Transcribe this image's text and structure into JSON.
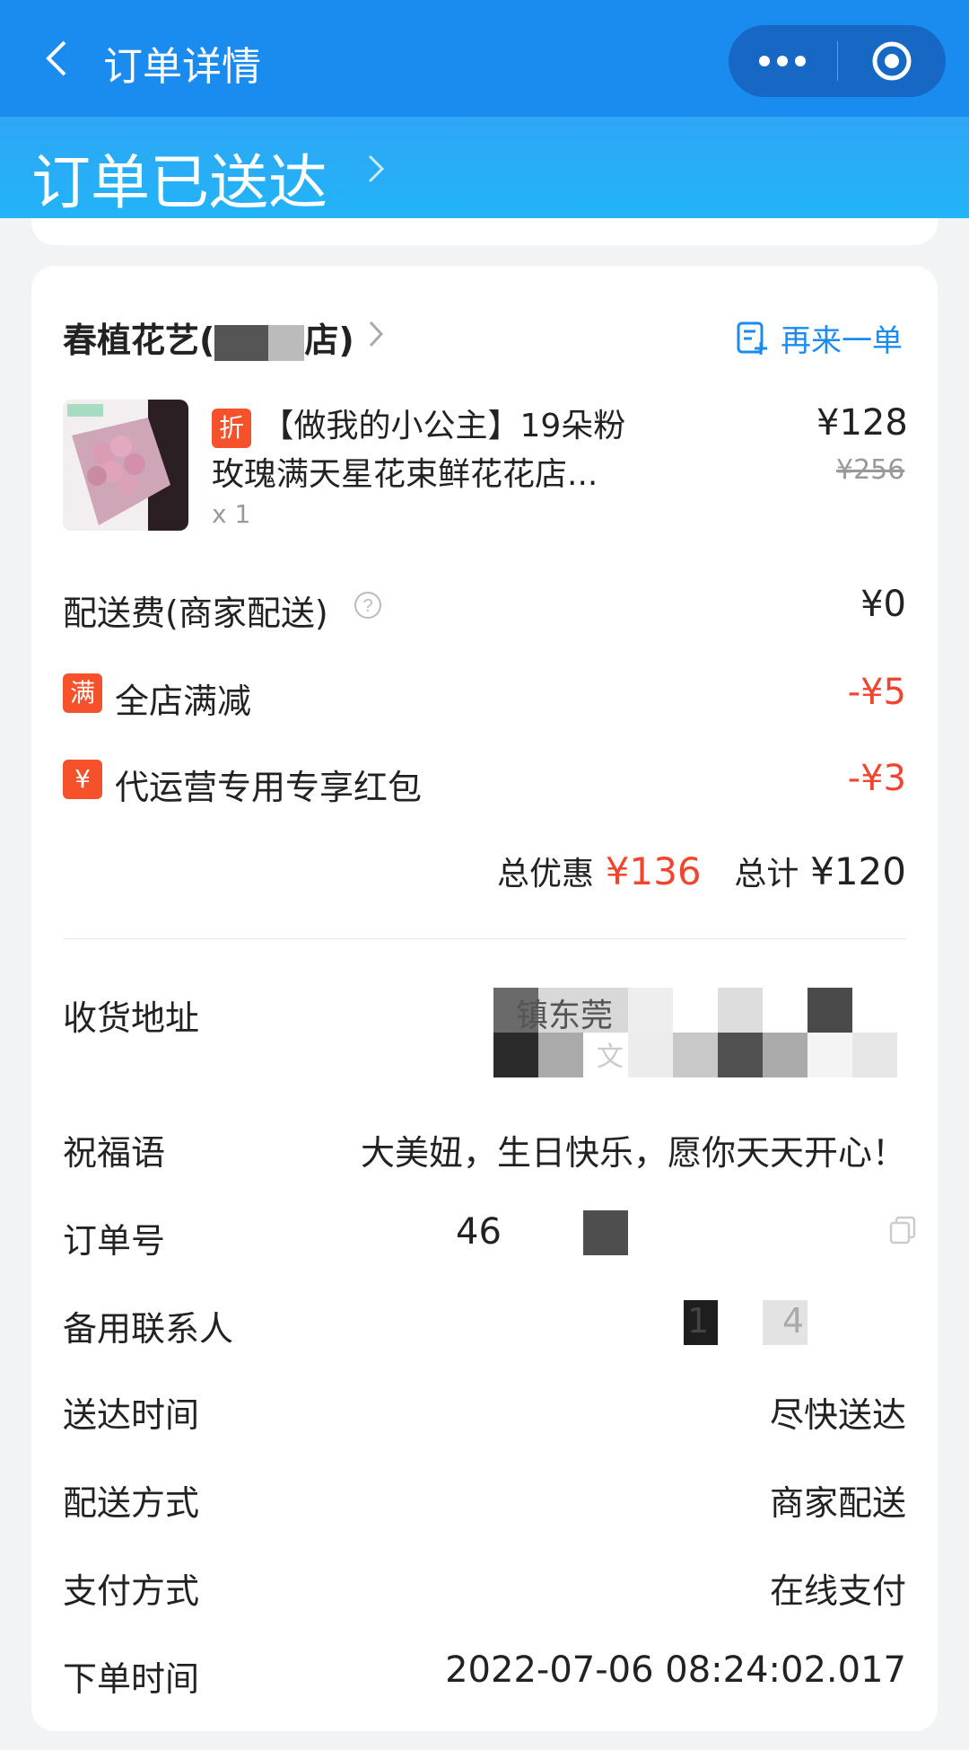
{
  "nav": {
    "title": "订单详情"
  },
  "status": {
    "text": "订单已送达"
  },
  "shop": {
    "name_prefix": "春植花艺(",
    "name_suffix": "店)",
    "reorder_label": "再来一单"
  },
  "product": {
    "tag": "折",
    "title_line1": "【做我的小公主】19朵粉",
    "title_line2": "玫瑰满天星花束鲜花花店...",
    "quantity": "x 1",
    "price": "¥128",
    "original_price": "¥256"
  },
  "fees": {
    "delivery_label": "配送费(商家配送)",
    "delivery_value": "¥0",
    "discount1_tag": "满",
    "discount1_label": "全店满减",
    "discount1_value": "-¥5",
    "discount2_tag": "¥",
    "discount2_label": "代运营专用专享红包",
    "discount2_value": "-¥3"
  },
  "summary": {
    "discount_label": "总优惠",
    "discount_value": "¥136",
    "total_label": "总计",
    "total_value": "¥120"
  },
  "info": {
    "address_label": "收货地址",
    "address_visible": "镇东莞",
    "address_line2_fragment": "文",
    "blessing_label": "祝福语",
    "blessing_value": "大美妞，生日快乐，愿你天天开心！",
    "order_no_label": "订单号",
    "order_no_prefix": "46",
    "backup_contact_label": "备用联系人",
    "backup_contact_a": "1",
    "backup_contact_b": "4",
    "delivery_time_label": "送达时间",
    "delivery_time_value": "尽快送达",
    "delivery_method_label": "配送方式",
    "delivery_method_value": "商家配送",
    "payment_label": "支付方式",
    "payment_value": "在线支付",
    "order_time_label": "下单时间",
    "order_time_value": "2022-07-06 08:24:02.017"
  },
  "colors": {
    "accent": "#1a8cf0",
    "discount_red": "#f0452f",
    "tag_orange": "#f5512a"
  },
  "icons": [
    "back-icon",
    "more-icon",
    "target-icon",
    "chevron-right-icon",
    "reorder-icon",
    "question-icon",
    "copy-icon"
  ]
}
